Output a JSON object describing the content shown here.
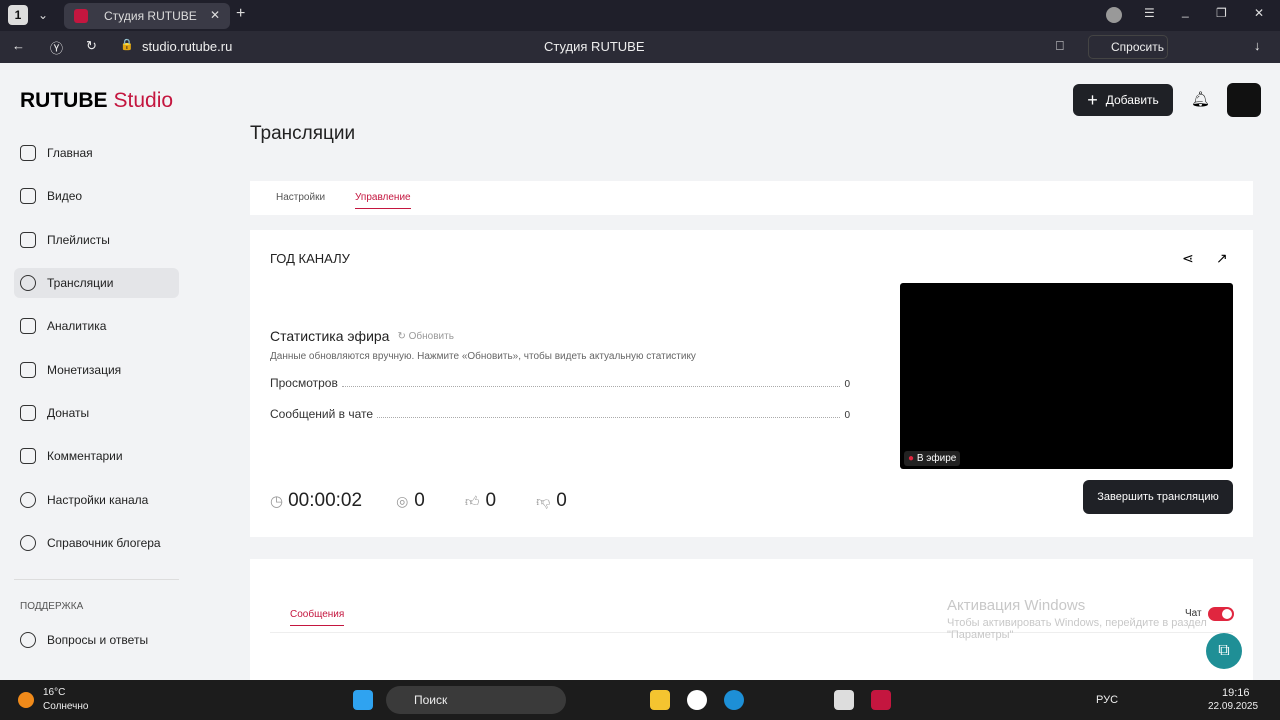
{
  "browser": {
    "tab_count": "1",
    "tab_title": "Студия RUTUBE",
    "url": "studio.rutube.ru",
    "page_title": "Студия RUTUBE",
    "ask_label": "Спросить"
  },
  "header": {
    "logo_main": "RUTUBE",
    "logo_studio": "Studio",
    "add_label": "Добавить"
  },
  "sidebar": {
    "items": [
      {
        "label": "Главная"
      },
      {
        "label": "Видео"
      },
      {
        "label": "Плейлисты"
      },
      {
        "label": "Трансляции"
      },
      {
        "label": "Аналитика"
      },
      {
        "label": "Монетизация"
      },
      {
        "label": "Донаты"
      },
      {
        "label": "Комментарии"
      },
      {
        "label": "Настройки канала"
      },
      {
        "label": "Справочник блогера"
      }
    ],
    "support_heading": "ПОДДЕРЖКА",
    "support_items": [
      {
        "label": "Вопросы и ответы"
      }
    ]
  },
  "main": {
    "page_title": "Трансляции",
    "tabs": [
      {
        "label": "Настройки"
      },
      {
        "label": "Управление"
      }
    ],
    "stream_title": "ГОД КАНАЛУ",
    "stats": {
      "title": "Статистика эфира",
      "refresh_label": "Обновить",
      "note": "Данные обновляются вручную. Нажмите «Обновить», чтобы видеть актуальную статистику",
      "rows": [
        {
          "label": "Просмотров",
          "value": "0"
        },
        {
          "label": "Сообщений в чате",
          "value": "0"
        }
      ]
    },
    "timer": "00:00:02",
    "viewers": "0",
    "likes": "0",
    "dislikes": "0",
    "live_badge": "В эфире",
    "end_button": "Завершить трансляцию",
    "chat_tab": "Сообщения",
    "chat_toggle_label": "Чат",
    "chat_enabled": true
  },
  "watermark": {
    "title": "Активация Windows",
    "text": "Чтобы активировать Windows, перейдите в раздел \"Параметры\""
  },
  "taskbar": {
    "temp": "16°C",
    "weather": "Солнечно",
    "search": "Поиск",
    "lang": "РУС",
    "time": "19:16",
    "date": "22.09.2025"
  },
  "colors": {
    "accent": "#c4163f",
    "dark": "#1f2126",
    "fab": "#1f8f96"
  }
}
